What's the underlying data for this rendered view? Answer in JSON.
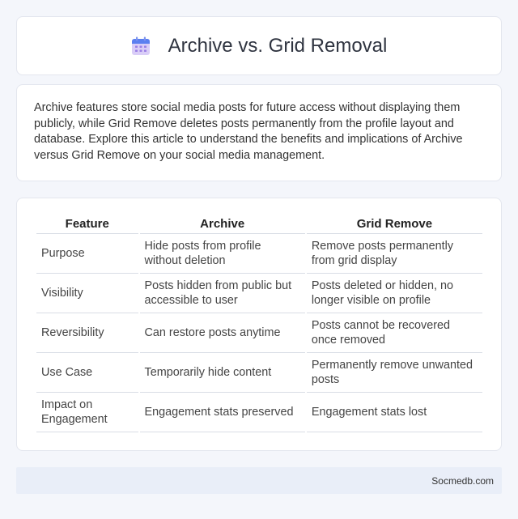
{
  "header": {
    "title": "Archive vs. Grid Removal",
    "icon": "calendar-icon",
    "icon_colors": {
      "top": "#5b7ff0",
      "body": "#c8b8f4",
      "dots": "#9b7fe6"
    }
  },
  "intro": {
    "text": "Archive features store social media posts for future access without displaying them publicly, while Grid Remove deletes posts permanently from the profile layout and database. Explore this article to understand the benefits and implications of Archive versus Grid Remove on your social media management."
  },
  "table": {
    "headers": [
      "Feature",
      "Archive",
      "Grid Remove"
    ],
    "rows": [
      [
        "Purpose",
        "Hide posts from profile without deletion",
        "Remove posts permanently from grid display"
      ],
      [
        "Visibility",
        "Posts hidden from public but accessible to user",
        "Posts deleted or hidden, no longer visible on profile"
      ],
      [
        "Reversibility",
        "Can restore posts anytime",
        "Posts cannot be recovered once removed"
      ],
      [
        "Use Case",
        "Temporarily hide content",
        "Permanently remove unwanted posts"
      ],
      [
        "Impact on Engagement",
        "Engagement stats preserved",
        "Engagement stats lost"
      ]
    ]
  },
  "footer": {
    "text": "Socmedb.com"
  }
}
